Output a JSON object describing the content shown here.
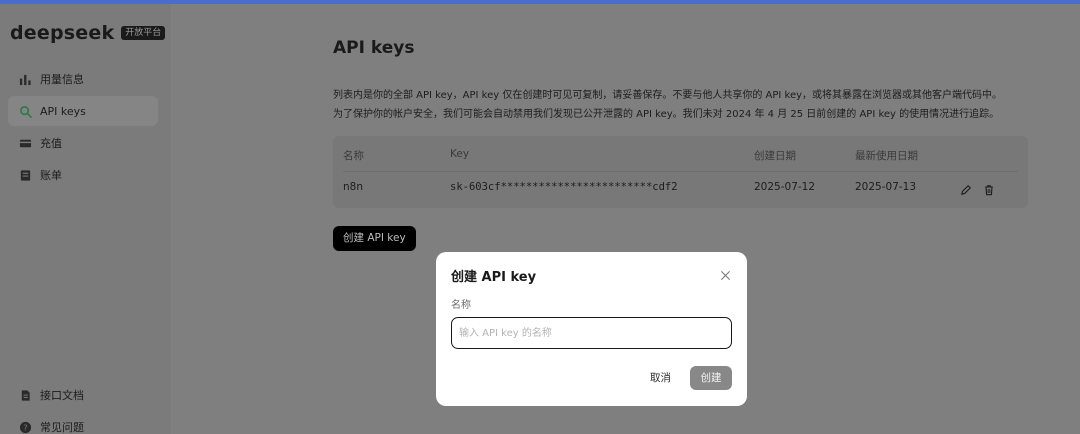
{
  "brand": {
    "logo": "deepseek",
    "badge": "开放平台"
  },
  "sidebar": {
    "items": [
      {
        "label": "用量信息",
        "icon": "bar-chart-icon",
        "active": false
      },
      {
        "label": "API keys",
        "icon": "search-icon",
        "active": true
      },
      {
        "label": "充值",
        "icon": "card-icon",
        "active": false
      },
      {
        "label": "账单",
        "icon": "bill-icon",
        "active": false
      }
    ],
    "bottom_items": [
      {
        "label": "接口文档",
        "icon": "document-icon"
      },
      {
        "label": "常见问题",
        "icon": "help-icon"
      }
    ]
  },
  "main": {
    "title": "API keys",
    "description": [
      "列表内是你的全部 API key，API key 仅在创建时可见可复制，请妥善保存。不要与他人共享你的 API key，或将其暴露在浏览器或其他客户端代码中。",
      "为了保护你的帐户安全，我们可能会自动禁用我们发现已公开泄露的 API key。我们未对 2024 年 4 月 25 日前创建的 API key 的使用情况进行追踪。"
    ],
    "table": {
      "headers": [
        "名称",
        "Key",
        "创建日期",
        "最新使用日期"
      ],
      "rows": [
        {
          "name": "n8n",
          "key": "sk-603cf************************cdf2",
          "created": "2025-07-12",
          "last_used": "2025-07-13"
        }
      ]
    },
    "create_button": "创建 API key"
  },
  "modal": {
    "title": "创建 API key",
    "field_label": "名称",
    "input_value": "",
    "input_placeholder": "输入 API key 的名称",
    "cancel_label": "取消",
    "confirm_label": "创建"
  },
  "colors": {
    "accent": "#4a6ccc",
    "button_dark": "#000000",
    "active_icon": "#2f7a4a"
  }
}
